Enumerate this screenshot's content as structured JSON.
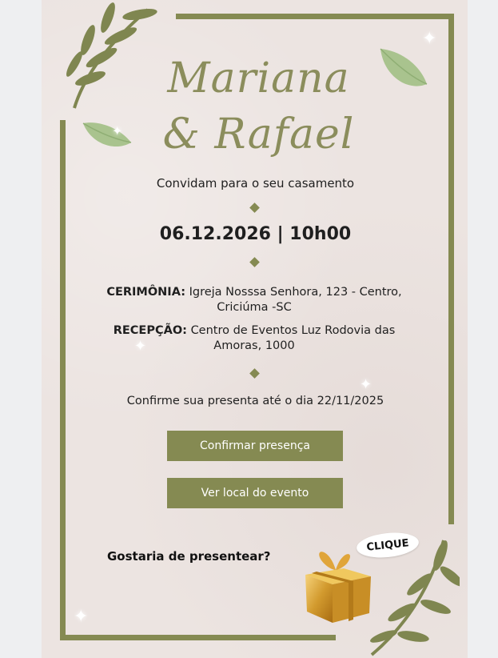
{
  "invitation": {
    "names_line1": "Mariana",
    "names_line2": "& Rafael",
    "subtitle": "Convidam para o seu casamento",
    "date_time": "06.12.2026 | 10h00",
    "ceremony_label": "CERIMÔNIA:",
    "ceremony_text": "Igreja Nosssa Senhora, 123 - Centro, Criciúma -SC",
    "reception_label": "RECEPÇÃO:",
    "reception_text": "Centro de Eventos Luz Rodovia das Amoras, 1000",
    "rsvp_note": "Confirme sua presenta até o dia 22/11/2025",
    "confirm_button": "Confirmar presença",
    "location_button": "Ver local do evento",
    "gift_question": "Gostaria de presentear?",
    "gift_bubble": "CLIQUE"
  },
  "colors": {
    "accent": "#858a52",
    "names": "#8b8d5c",
    "card_background": "#ece4e1",
    "page_background": "#eeeff1"
  },
  "icons": [
    "olive-branch-icon",
    "leaf-icon",
    "sparkle-icon",
    "diamond-divider-icon",
    "gift-box-icon"
  ]
}
